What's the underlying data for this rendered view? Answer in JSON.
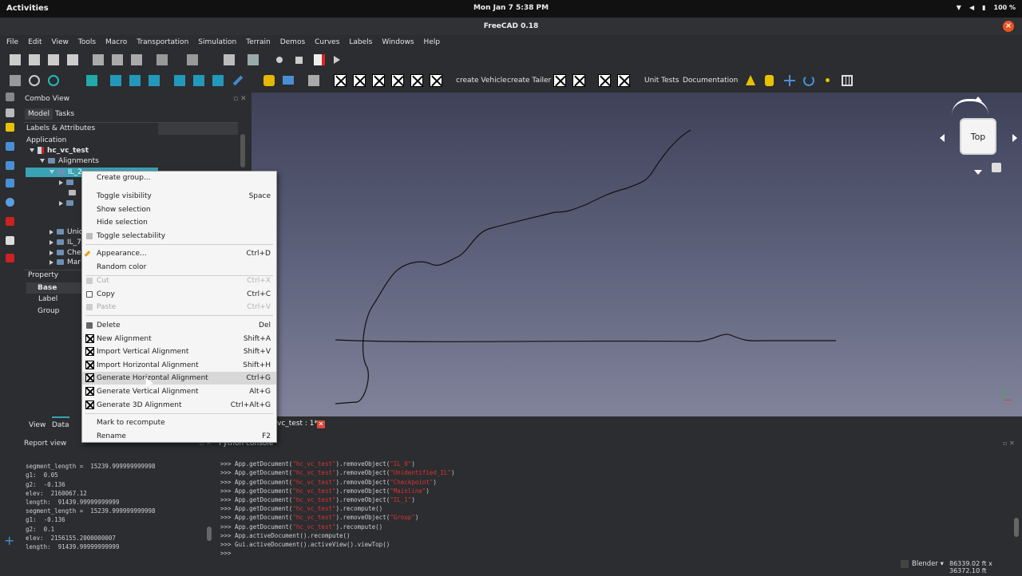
{
  "topbar": {
    "activities": "Activities",
    "clock": "Mon Jan 7   5:38 PM",
    "battery": "100 %"
  },
  "window": {
    "title": "FreeCAD 0.18",
    "close": "×"
  },
  "menubar": [
    "File",
    "Edit",
    "View",
    "Tools",
    "Macro",
    "Transportation",
    "Simulation",
    "Terrain",
    "Demos",
    "Curves",
    "Labels",
    "Windows",
    "Help"
  ],
  "toolbar2": {
    "create_vehicle": "create Vehicle",
    "create_tailer": "create Tailer",
    "unit_tests": "Unit Tests",
    "documentation": "Documentation"
  },
  "combo": {
    "title": "Combo View",
    "tabs": [
      "Model",
      "Tasks"
    ],
    "tree_header": "Labels & Attributes",
    "application": "Application",
    "doc": "hc_vc_test",
    "alignments": "Alignments",
    "selected": "IL_2",
    "children": [
      "Unic",
      "IL_7",
      "Che",
      "Mar"
    ]
  },
  "property": {
    "header": "Property",
    "base": "Base",
    "label": "Label",
    "group": "Group",
    "tabs": [
      "View",
      "Data"
    ]
  },
  "context_menu": {
    "items": [
      {
        "label": "Create group...",
        "shortcut": ""
      },
      {
        "label": "Toggle visibility",
        "shortcut": "Space"
      },
      {
        "label": "Show selection",
        "shortcut": ""
      },
      {
        "label": "Hide selection",
        "shortcut": ""
      },
      {
        "label": "Toggle selectability",
        "shortcut": ""
      },
      {
        "label": "Appearance...",
        "shortcut": "Ctrl+D"
      },
      {
        "label": "Random color",
        "shortcut": ""
      },
      {
        "label": "Cut",
        "shortcut": "Ctrl+X"
      },
      {
        "label": "Copy",
        "shortcut": "Ctrl+C"
      },
      {
        "label": "Paste",
        "shortcut": "Ctrl+V"
      },
      {
        "label": "Delete",
        "shortcut": "Del"
      },
      {
        "label": "New Alignment",
        "shortcut": "Shift+A"
      },
      {
        "label": "Import Vertical Alignment",
        "shortcut": "Shift+V"
      },
      {
        "label": "Import Horizontal Alignment",
        "shortcut": "Shift+H"
      },
      {
        "label": "Generate Horizontal Alignment",
        "shortcut": "Ctrl+G"
      },
      {
        "label": "Generate Vertical Alignment",
        "shortcut": "Alt+G"
      },
      {
        "label": "Generate 3D Alignment",
        "shortcut": "Ctrl+Alt+G"
      },
      {
        "label": "Mark to recompute",
        "shortcut": ""
      },
      {
        "label": "Rename",
        "shortcut": "F2"
      }
    ]
  },
  "navcube": {
    "face": "Top"
  },
  "doc_tab": "vc_test : 1*",
  "report": {
    "title": "Report view",
    "lines": [
      "segment_length =  15239.999999999998",
      "g1:  0.05",
      "g2:  -0.136",
      "elev:  2160067.12",
      "length:  91439.99999999999",
      "segment_length =  15239.999999999998",
      "g1:  -0.136",
      "g2:  0.1",
      "elev:  2156155.2000000007",
      "length:  91439.99999999999"
    ]
  },
  "python": {
    "title": "Python console",
    "lines": [
      ">>> App.getDocument(\"hc_vc_test\").removeObject(\"IL_0\")",
      ">>> App.getDocument(\"hc_vc_test\").removeObject(\"Unidentified_IL\")",
      ">>> App.getDocument(\"hc_vc_test\").removeObject(\"Checkpoint\")",
      ">>> App.getDocument(\"hc_vc_test\").removeObject(\"Mainline\")",
      ">>> App.getDocument(\"hc_vc_test\").removeObject(\"IL_1\")",
      ">>> App.getDocument(\"hc_vc_test\").recompute()",
      ">>> App.getDocument(\"hc_vc_test\").removeObject(\"Group\")",
      ">>> App.getDocument(\"hc_vc_test\").recompute()",
      ">>> App.activeDocument().recompute()",
      ">>> Gui.activeDocument().activeView().viewTop()",
      ">>>"
    ]
  },
  "status": {
    "nav_style": "Blender",
    "dimensions": "86339.02 ft x 36372.10 ft"
  }
}
